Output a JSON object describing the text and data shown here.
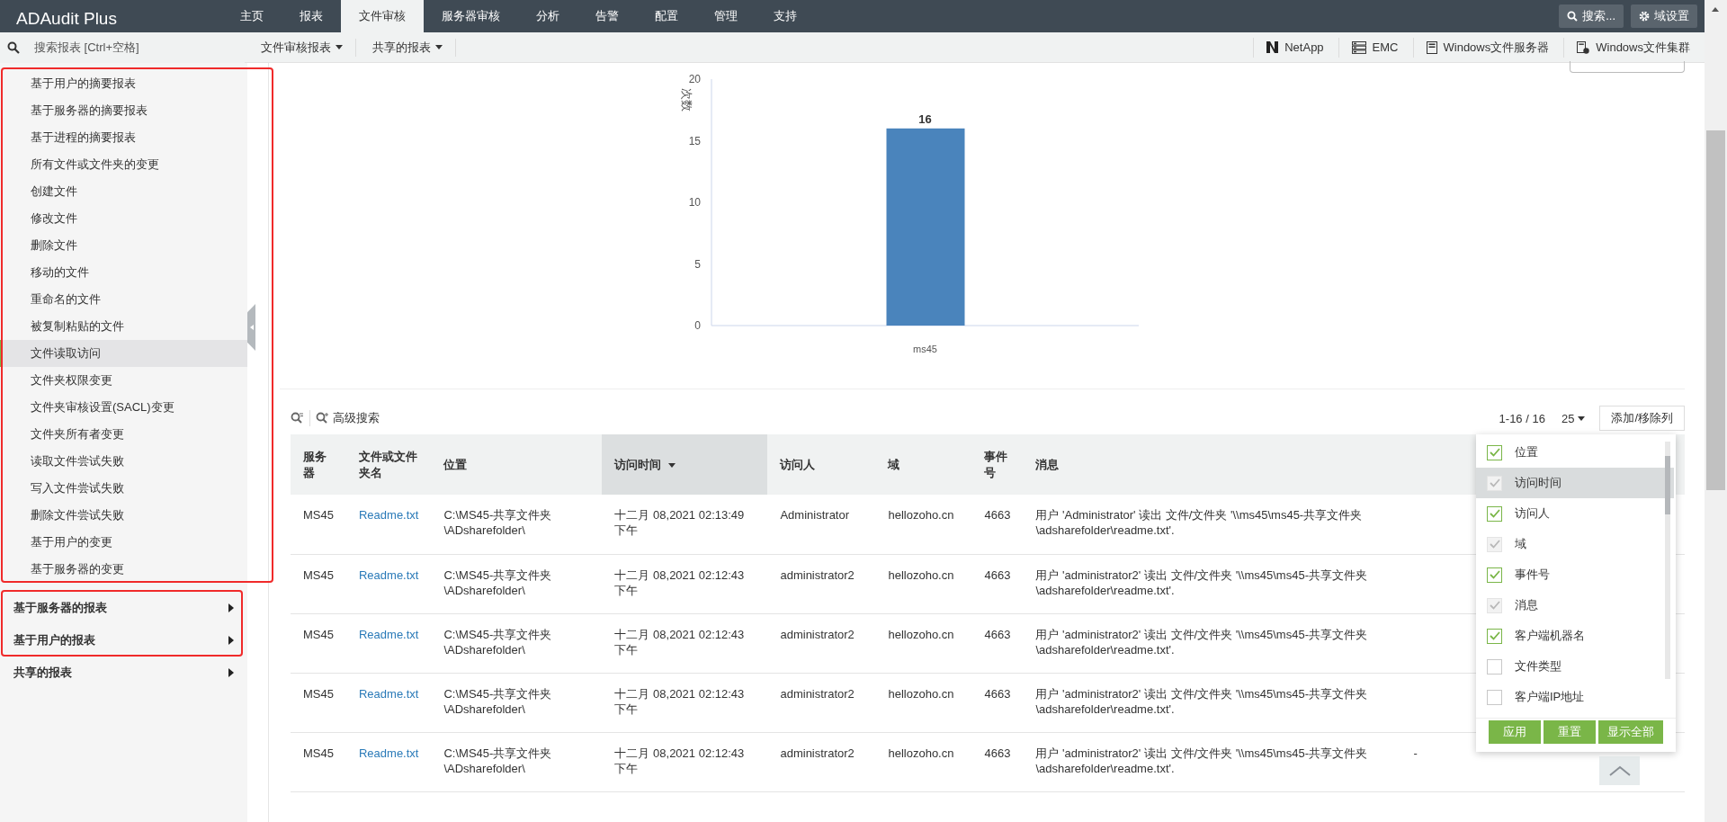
{
  "app": {
    "logo": "ADAudit Plus"
  },
  "nav": {
    "tabs": [
      {
        "label": "主页",
        "selected": false
      },
      {
        "label": "报表",
        "selected": false
      },
      {
        "label": "文件审核",
        "selected": true
      },
      {
        "label": "服务器审核",
        "selected": false
      },
      {
        "label": "分析",
        "selected": false
      },
      {
        "label": "告警",
        "selected": false
      },
      {
        "label": "配置",
        "selected": false
      },
      {
        "label": "管理",
        "selected": false
      },
      {
        "label": "支持",
        "selected": false
      }
    ],
    "search_button": "搜索...",
    "domain_button": "域设置"
  },
  "subbar": {
    "search": {
      "placeholder": "搜索报表 [Ctrl+空格]"
    },
    "menus": [
      "文件审核报表",
      "共享的报表"
    ],
    "servers": [
      {
        "label": "NetApp",
        "kind": "netapp"
      },
      {
        "label": "EMC",
        "kind": "emc"
      },
      {
        "label": "Windows文件服务器",
        "kind": "server"
      },
      {
        "label": "Windows文件集群",
        "kind": "cluster"
      }
    ]
  },
  "sidebar": {
    "items": [
      {
        "label": "基于用户的摘要报表",
        "selected": false
      },
      {
        "label": "基于服务器的摘要报表",
        "selected": false
      },
      {
        "label": "基于进程的摘要报表",
        "selected": false
      },
      {
        "label": "所有文件或文件夹的变更",
        "selected": false
      },
      {
        "label": "创建文件",
        "selected": false
      },
      {
        "label": "修改文件",
        "selected": false
      },
      {
        "label": "删除文件",
        "selected": false
      },
      {
        "label": "移动的文件",
        "selected": false
      },
      {
        "label": "重命名的文件",
        "selected": false
      },
      {
        "label": "被复制粘贴的文件",
        "selected": false
      },
      {
        "label": "文件读取访问",
        "selected": true
      },
      {
        "label": "文件夹权限变更",
        "selected": false
      },
      {
        "label": "文件夹审核设置(SACL)变更",
        "selected": false
      },
      {
        "label": "文件夹所有者变更",
        "selected": false
      },
      {
        "label": "读取文件尝试失败",
        "selected": false
      },
      {
        "label": "写入文件尝试失败",
        "selected": false
      },
      {
        "label": "删除文件尝试失败",
        "selected": false
      },
      {
        "label": "基于用户的变更",
        "selected": false
      },
      {
        "label": "基于服务器的变更",
        "selected": false
      }
    ],
    "groups": [
      {
        "label": "基于服务器的报表"
      },
      {
        "label": "基于用户的报表"
      },
      {
        "label": "共享的报表"
      }
    ]
  },
  "chart": {
    "chart_data": {
      "type": "bar",
      "ylabel": "次数",
      "categories": [
        "ms45"
      ],
      "series": [
        {
          "color": "#4a84bc",
          "values": [
            16
          ]
        }
      ],
      "ylim": [
        0,
        20
      ],
      "yticks": [
        0,
        5,
        10,
        15,
        20
      ],
      "data_labels": true
    }
  },
  "table": {
    "advanced_search": "高级搜索",
    "pagination": "1-16 / 16",
    "page_size": "25",
    "columns_button": "添加/移除列",
    "columns": [
      {
        "label": "服务器",
        "sorted": false
      },
      {
        "label": "文件或文件夹名",
        "sorted": false
      },
      {
        "label": "位置",
        "sorted": false
      },
      {
        "label": "访问时间",
        "sorted": true
      },
      {
        "label": "访问人",
        "sorted": false
      },
      {
        "label": "域",
        "sorted": false
      },
      {
        "label": "事件号",
        "sorted": false
      },
      {
        "label": "消息",
        "sorted": false
      }
    ],
    "rows": [
      {
        "server": "MS45",
        "name": "Readme.txt",
        "location": "C:\\MS45-共享文件夹\n\\ADsharefolder\\",
        "time": "十二月 08,2021 02:13:49\n下午",
        "user": "Administrator",
        "domain": "hellozoho.cn",
        "event": "4663",
        "message": "用户 'Administrator' 读出 文件/文件夹 '\\\\ms45\\ms45-共享文件夹\n\\adsharefolder\\readme.txt'."
      },
      {
        "server": "MS45",
        "name": "Readme.txt",
        "location": "C:\\MS45-共享文件夹\n\\ADsharefolder\\",
        "time": "十二月 08,2021 02:12:43\n下午",
        "user": "administrator2",
        "domain": "hellozoho.cn",
        "event": "4663",
        "message": "用户 'administrator2' 读出 文件/文件夹 '\\\\ms45\\ms45-共享文件夹\n\\adsharefolder\\readme.txt'."
      },
      {
        "server": "MS45",
        "name": "Readme.txt",
        "location": "C:\\MS45-共享文件夹\n\\ADsharefolder\\",
        "time": "十二月 08,2021 02:12:43\n下午",
        "user": "administrator2",
        "domain": "hellozoho.cn",
        "event": "4663",
        "message": "用户 'administrator2' 读出 文件/文件夹 '\\\\ms45\\ms45-共享文件夹\n\\adsharefolder\\readme.txt'."
      },
      {
        "server": "MS45",
        "name": "Readme.txt",
        "location": "C:\\MS45-共享文件夹\n\\ADsharefolder\\",
        "time": "十二月 08,2021 02:12:43\n下午",
        "user": "administrator2",
        "domain": "hellozoho.cn",
        "event": "4663",
        "message": "用户 'administrator2' 读出 文件/文件夹 '\\\\ms45\\ms45-共享文件夹\n\\adsharefolder\\readme.txt'."
      },
      {
        "server": "MS45",
        "name": "Readme.txt",
        "location": "C:\\MS45-共享文件夹\n\\ADsharefolder\\",
        "time": "十二月 08,2021 02:12:43\n下午",
        "user": "administrator2",
        "domain": "hellozoho.cn",
        "event": "4663",
        "message": "用户 'administrator2' 读出 文件/文件夹 '\\\\ms45\\ms45-共享文件夹\n\\adsharefolder\\readme.txt'.",
        "column_9": "-"
      }
    ]
  },
  "column_picker": {
    "items": [
      {
        "label": "位置",
        "checked": true,
        "disabled": false,
        "selected": false
      },
      {
        "label": "访问时间",
        "checked": true,
        "disabled": true,
        "selected": true
      },
      {
        "label": "访问人",
        "checked": true,
        "disabled": false,
        "selected": false
      },
      {
        "label": "域",
        "checked": true,
        "disabled": true,
        "selected": false
      },
      {
        "label": "事件号",
        "checked": true,
        "disabled": false,
        "selected": false
      },
      {
        "label": "消息",
        "checked": true,
        "disabled": true,
        "selected": false
      },
      {
        "label": "客户端机器名",
        "checked": true,
        "disabled": false,
        "selected": false
      },
      {
        "label": "文件类型",
        "checked": false,
        "disabled": false,
        "selected": false
      },
      {
        "label": "客户端IP地址",
        "checked": false,
        "disabled": false,
        "selected": false
      }
    ],
    "buttons": [
      "应用",
      "重置",
      "显示全部"
    ]
  }
}
